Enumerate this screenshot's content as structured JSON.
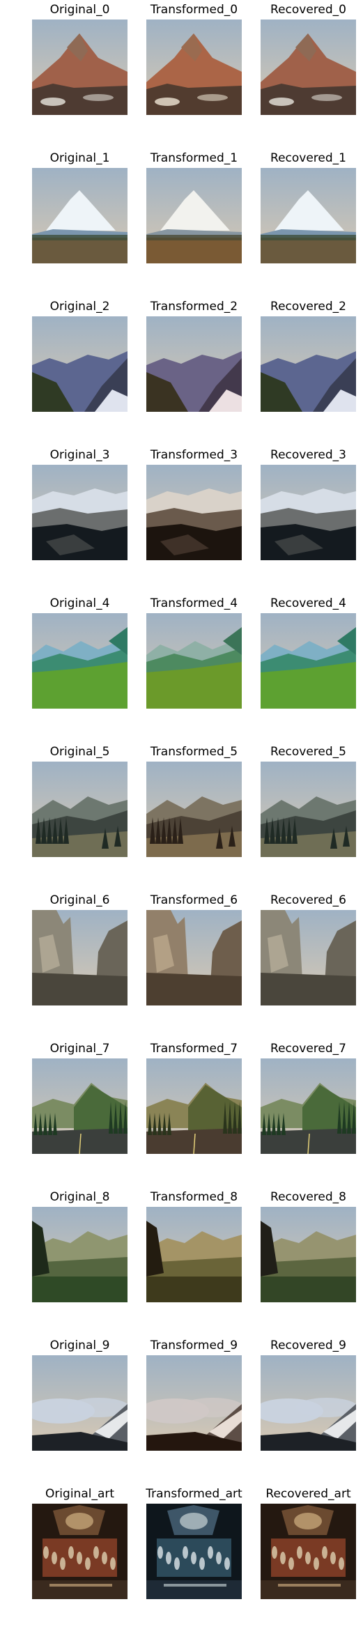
{
  "rows": [
    {
      "labels": [
        "Original_0",
        "Transformed_0",
        "Recovered_0"
      ],
      "scene": "peak",
      "palettes": [
        {
          "sky": "#9fb2c4",
          "sky2": "#d8c9b3",
          "far": "#8f6a55",
          "mid": "#a0614a",
          "ground": "#4e3b32",
          "accent": "#c9c3bb"
        },
        {
          "sky": "#a8b3bf",
          "sky2": "#e0c6a8",
          "far": "#9a6b50",
          "mid": "#ab6547",
          "ground": "#523c2f",
          "accent": "#d0c4b4"
        },
        {
          "sky": "#9fb2c4",
          "sky2": "#d8c9b3",
          "far": "#8f6a55",
          "mid": "#a0614a",
          "ground": "#4e3b32",
          "accent": "#c9c3bb"
        }
      ]
    },
    {
      "labels": [
        "Original_1",
        "Transformed_1",
        "Recovered_1"
      ],
      "scene": "snowpeak",
      "palettes": [
        {
          "sky": "#8fb9d2",
          "sky2": "#c3dbe8",
          "far": "#eef4f8",
          "mid": "#7b96ae",
          "ground": "#6a5a3e",
          "accent": "#3d4e3a"
        },
        {
          "sky": "#95b8c9",
          "sky2": "#d1dadb",
          "far": "#f2f2ee",
          "mid": "#8796a1",
          "ground": "#7a5a34",
          "accent": "#4a4a34"
        },
        {
          "sky": "#8fb9d2",
          "sky2": "#c3dbe8",
          "far": "#eef4f8",
          "mid": "#7b96ae",
          "ground": "#6a5a3e",
          "accent": "#3d4e3a"
        }
      ]
    },
    {
      "labels": [
        "Original_2",
        "Transformed_2",
        "Recovered_2"
      ],
      "scene": "valley",
      "palettes": [
        {
          "sky": "#b9c3e3",
          "sky2": "#e4e6f2",
          "far": "#5c6690",
          "mid": "#3a3f55",
          "ground": "#2f3a24",
          "accent": "#dfe3ee"
        },
        {
          "sky": "#c8bfd9",
          "sky2": "#efe2e6",
          "far": "#6a6386",
          "mid": "#43394c",
          "ground": "#3a3322",
          "accent": "#ece0e2"
        },
        {
          "sky": "#b9c3e3",
          "sky2": "#e4e6f2",
          "far": "#5c6690",
          "mid": "#3a3f55",
          "ground": "#2f3a24",
          "accent": "#dfe3ee"
        }
      ]
    },
    {
      "labels": [
        "Original_3",
        "Transformed_3",
        "Recovered_3"
      ],
      "scene": "night",
      "palettes": [
        {
          "sky": "#1e3f6b",
          "sky2": "#3b6ea1",
          "far": "#d6dde6",
          "mid": "#6b6e6e",
          "ground": "#141a1f",
          "accent": "#3a3e3f"
        },
        {
          "sky": "#2a3e5e",
          "sky2": "#55708c",
          "far": "#d9d2c9",
          "mid": "#6a5a4c",
          "ground": "#1c140e",
          "accent": "#3f3128"
        },
        {
          "sky": "#1e3f6b",
          "sky2": "#3b6ea1",
          "far": "#d6dde6",
          "mid": "#6b6e6e",
          "ground": "#141a1f",
          "accent": "#3a3e3f"
        }
      ]
    },
    {
      "labels": [
        "Original_4",
        "Transformed_4",
        "Recovered_4"
      ],
      "scene": "meadow",
      "palettes": [
        {
          "sky": "#f6fbfd",
          "sky2": "#ffffff",
          "far": "#7fb0c5",
          "mid": "#3c8c72",
          "ground": "#5da131",
          "accent": "#2f7a64"
        },
        {
          "sky": "#fdf8dc",
          "sky2": "#fffce9",
          "far": "#8fb0a6",
          "mid": "#4d8a60",
          "ground": "#6b9a2a",
          "accent": "#3b7458"
        },
        {
          "sky": "#f6fbfd",
          "sky2": "#ffffff",
          "far": "#7fb0c5",
          "mid": "#3c8c72",
          "ground": "#5da131",
          "accent": "#2f7a64"
        }
      ]
    },
    {
      "labels": [
        "Original_5",
        "Transformed_5",
        "Recovered_5"
      ],
      "scene": "forest",
      "palettes": [
        {
          "sky": "#b8ccd2",
          "sky2": "#e3ebe8",
          "far": "#6d7870",
          "mid": "#3d4540",
          "ground": "#6f6e55",
          "accent": "#1f2a24"
        },
        {
          "sky": "#d6c8b4",
          "sky2": "#f3e6d2",
          "far": "#7d7462",
          "mid": "#4c4236",
          "ground": "#7d6b4d",
          "accent": "#2a2018"
        },
        {
          "sky": "#b8ccd2",
          "sky2": "#e3ebe8",
          "far": "#6d7870",
          "mid": "#3d4540",
          "ground": "#6f6e55",
          "accent": "#1f2a24"
        }
      ]
    },
    {
      "labels": [
        "Original_6",
        "Transformed_6",
        "Recovered_6"
      ],
      "scene": "cliff",
      "palettes": [
        {
          "sky": "#6f9ee6",
          "sky2": "#8db6f0",
          "far": "#8c8778",
          "mid": "#6a6559",
          "ground": "#4a463c",
          "accent": "#b5ac98"
        },
        {
          "sky": "#8e9ab8",
          "sky2": "#aab0c4",
          "far": "#92806a",
          "mid": "#6e5e4c",
          "ground": "#4d3f30",
          "accent": "#bca88c"
        },
        {
          "sky": "#6f9ee6",
          "sky2": "#8db6f0",
          "far": "#8c8778",
          "mid": "#6a6559",
          "ground": "#4a463c",
          "accent": "#b5ac98"
        }
      ]
    },
    {
      "labels": [
        "Original_7",
        "Transformed_7",
        "Recovered_7"
      ],
      "scene": "road",
      "palettes": [
        {
          "sky": "#a9c6e0",
          "sky2": "#e6eef4",
          "far": "#7b8c63",
          "mid": "#4a6a3a",
          "ground": "#3b3f3c",
          "accent": "#1e3a22"
        },
        {
          "sky": "#c7c3b8",
          "sky2": "#f2e6d4",
          "far": "#8a8456",
          "mid": "#586234",
          "ground": "#4a3c30",
          "accent": "#2a341c"
        },
        {
          "sky": "#a9c6e0",
          "sky2": "#e6eef4",
          "far": "#7b8c63",
          "mid": "#4a6a3a",
          "ground": "#3b3f3c",
          "accent": "#1e3a22"
        }
      ]
    },
    {
      "labels": [
        "Original_8",
        "Transformed_8",
        "Recovered_8"
      ],
      "scene": "lake",
      "palettes": [
        {
          "sky": "#d9dde0",
          "sky2": "#f4f4f2",
          "far": "#8f9670",
          "mid": "#556640",
          "ground": "#2f4a26",
          "accent": "#1e2a1a"
        },
        {
          "sky": "#f4d9b4",
          "sky2": "#fff2dc",
          "far": "#a49466",
          "mid": "#6a6438",
          "ground": "#3e3a1c",
          "accent": "#231c10"
        },
        {
          "sky": "#e3ddd6",
          "sky2": "#f7f2ea",
          "far": "#969470",
          "mid": "#5c6640",
          "ground": "#334626",
          "accent": "#201f18"
        }
      ]
    },
    {
      "labels": [
        "Original_9",
        "Transformed_9",
        "Recovered_9"
      ],
      "scene": "clouds",
      "palettes": [
        {
          "sky": "#3c5a8c",
          "sky2": "#8ea4c8",
          "far": "#c9d2de",
          "mid": "#5a5f66",
          "ground": "#1d2126",
          "accent": "#e6e8ea"
        },
        {
          "sky": "#4e5478",
          "sky2": "#9c98ac",
          "far": "#cfc8c6",
          "mid": "#5d4e46",
          "ground": "#24160e",
          "accent": "#e8ddd5"
        },
        {
          "sky": "#3c5a8c",
          "sky2": "#8ea4c8",
          "far": "#c9d2de",
          "mid": "#5a5f66",
          "ground": "#1d2126",
          "accent": "#e6e8ea"
        }
      ]
    },
    {
      "labels": [
        "Original_art",
        "Transformed_art",
        "Recovered_art"
      ],
      "scene": "art",
      "palettes": [
        {
          "sky": "#3a2a1e",
          "sky2": "#6b4a30",
          "far": "#c4a478",
          "mid": "#7a3a24",
          "ground": "#241810",
          "accent": "#d8c8a8"
        },
        {
          "sky": "#1e2a36",
          "sky2": "#3e5668",
          "far": "#b8c4c8",
          "mid": "#2c4a5a",
          "ground": "#0e161c",
          "accent": "#d4dce0"
        },
        {
          "sky": "#3a2a1e",
          "sky2": "#6b4a30",
          "far": "#c4a478",
          "mid": "#7a3a24",
          "ground": "#241810",
          "accent": "#d8c8a8"
        }
      ]
    }
  ]
}
